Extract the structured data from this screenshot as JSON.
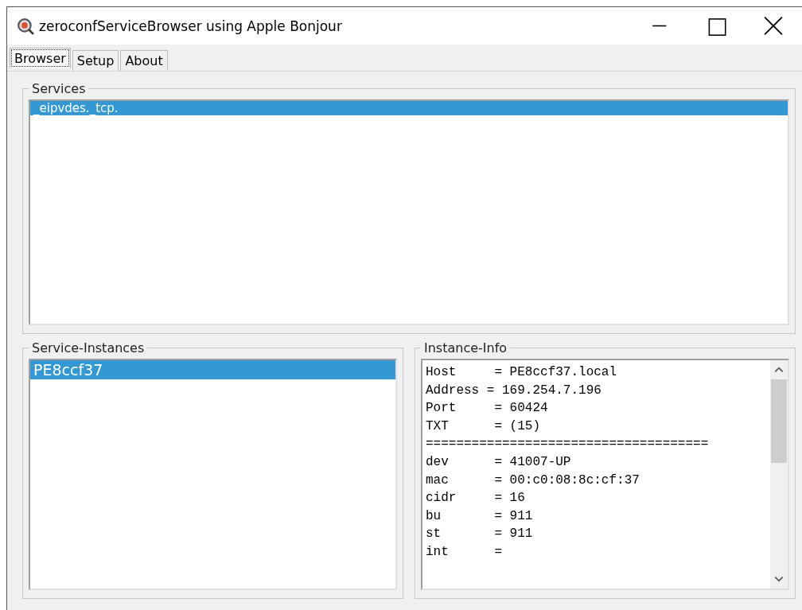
{
  "window": {
    "title": "zeroconfServiceBrowser using Apple Bonjour"
  },
  "tabs": [
    {
      "label": "Browser",
      "selected": true
    },
    {
      "label": "Setup",
      "selected": false
    },
    {
      "label": "About",
      "selected": false
    }
  ],
  "services": {
    "title": "Services",
    "items": [
      {
        "label": "_eipvdes._tcp.",
        "selected": true
      }
    ]
  },
  "service_instances": {
    "title": "Service-Instances",
    "items": [
      {
        "label": "PE8ccf37",
        "selected": true
      }
    ]
  },
  "instance_info": {
    "title": "Instance-Info",
    "lines": [
      "Host     = PE8ccf37.local",
      "Address = 169.254.7.196",
      "Port     = 60424",
      "TXT      = (15)",
      "=====================================",
      "dev      = 41007-UP",
      "mac      = 00:c0:08:8c:cf:37",
      "cidr     = 16",
      "bu       = 911",
      "st       = 911",
      "int      ="
    ]
  }
}
